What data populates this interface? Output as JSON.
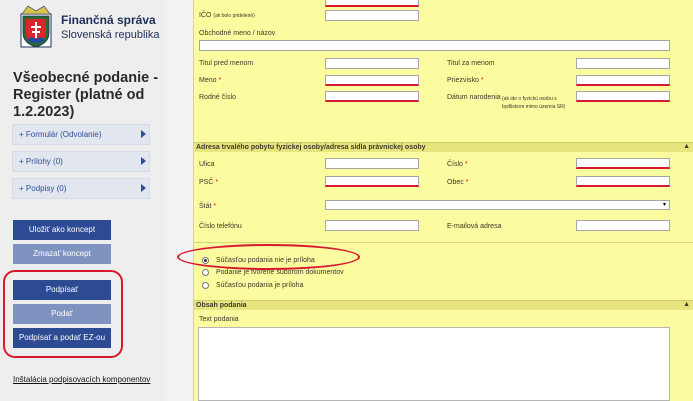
{
  "sidebar": {
    "org_name": "Finančná správa",
    "org_sub": "Slovenská republika",
    "title": "Všeobecné podanie - Register (platné od 1.2.2023)",
    "accordion": [
      {
        "label": "Formulár (Odvolanie)"
      },
      {
        "label": "Prílohy (0)"
      },
      {
        "label": "Podpisy (0)"
      }
    ],
    "buttons": {
      "save_draft": "Uložiť ako koncept",
      "delete_draft": "Zmazať koncept",
      "sign": "Podpísať",
      "submit": "Podať",
      "sign_submit_ez": "Podpísať a podať EZ-ou"
    },
    "install_link": "Inštalácia podpisovacích komponentov"
  },
  "form": {
    "top": {
      "ico_label": "IČO",
      "ico_note": "(ak bolo pridelené)",
      "business_name_label": "Obchodné meno / názov"
    },
    "person": {
      "title_before": "Titul pred menom",
      "title_after": "Titul za menom",
      "first_name": "Meno",
      "surname": "Priezvisko",
      "birth_number": "Rodné číslo",
      "birth_date": "Dátum narodenia",
      "birth_date_note_1": "(ak ide o fyzickú osobu s",
      "birth_date_note_2": "bydliskom mimo územia SR)",
      "req_mark": "*"
    },
    "address": {
      "header": "Adresa trvalého pobytu fyzickej osoby/adresa sídla právnickej osoby",
      "collapse": "▲",
      "street": "Ulica",
      "number": "Číslo",
      "zip": "PSČ",
      "city": "Obec",
      "state": "Štát",
      "select_arrow": "▾",
      "phone": "Číslo telefónu",
      "email": "E-mailová adresa",
      "req_mark": "*"
    },
    "radio_options": [
      "Súčasťou podania nie je príloha",
      "Podanie je tvorené súborom dokumentov",
      "Súčasťou podania je príloha"
    ],
    "content": {
      "header": "Obsah podania",
      "collapse": "▲",
      "text_label": "Text podania"
    }
  },
  "colors": {
    "form_bg": "#fbfb9f",
    "accent_blue": "#2c4b92",
    "highlight_red": "#d8182e"
  }
}
